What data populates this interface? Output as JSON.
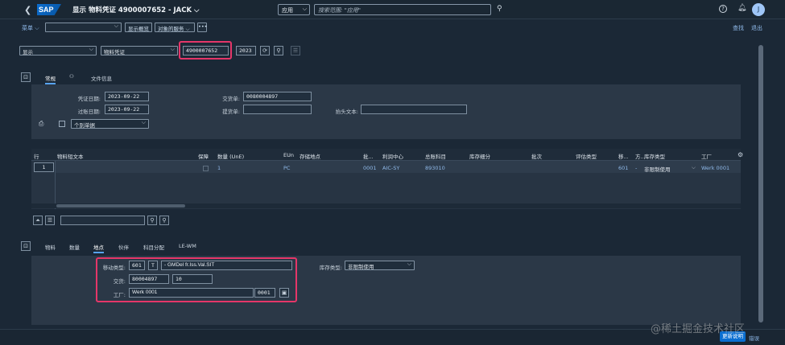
{
  "shell": {
    "back_icon": "chevron-left-icon",
    "logo_text": "SAP",
    "title": "显示 物料凭证 4900007652 - JACK ⌵",
    "scope": "应用",
    "search_placeholder": "搜索范围: \"应用\"",
    "avatar_letter": "J"
  },
  "toolbar": {
    "menu_label": "菜单 ⌵",
    "display_overview": "显示概览",
    "object_services": "对象的服务 ⌵",
    "more": "•••",
    "find": "查找",
    "exit": "退出"
  },
  "header_selection": {
    "action": "显示",
    "doc_type": "物料凭证",
    "doc_number": "4900007652",
    "year": "2023"
  },
  "header_tabs": [
    "常规",
    "文件信息"
  ],
  "general": {
    "doc_date_label": "凭证日期:",
    "doc_date": "2023-09-22",
    "posting_date_label": "过账日期:",
    "posting_date": "2023-09-22",
    "delivery_note_label": "交货单:",
    "delivery_note": "0080004897",
    "bill_lading_label": "提货单:",
    "bill_lading": "",
    "header_text_label": "抬头文本:",
    "header_text": "",
    "slip_option": "个别单据"
  },
  "items_table": {
    "headers": [
      "行",
      "物料短文本",
      "保障",
      "数量 (UnE)",
      "EUn",
      "存储地点",
      "批...",
      "利润中心",
      "总账科目",
      "库存细分",
      "批次",
      "评估类型",
      "移...",
      "方...",
      "库存类型",
      "工厂"
    ],
    "row": {
      "line": "1",
      "material_text": "",
      "quantity": "1",
      "unit": "PC",
      "batch_short": "0001",
      "profit_center": "AIC-SY",
      "gl_account": "893010",
      "movement": "601",
      "direction": "-",
      "stock_type": "非限制使用",
      "plant": "Werk 0001"
    }
  },
  "detail_tabs": [
    "物料",
    "数量",
    "地点",
    "伙伴",
    "科目分配",
    "LE-WM"
  ],
  "detail": {
    "movement_type_label": "移动类型:",
    "movement_type": "601",
    "movement_indicator": "T",
    "movement_text": "- GMDel fr.Iss.Val.SIT",
    "delivery_label": "交货:",
    "delivery_no": "80004897",
    "delivery_item": "10",
    "plant_label": "工厂:",
    "plant_name": "Werk 0001",
    "plant_code": "0001",
    "stock_type_label": "库存类型:",
    "stock_type": "非限制使用"
  },
  "footer": {
    "save_label": "更新说明",
    "check_label": "错误"
  },
  "watermark": "@稀土掘金技术社区"
}
